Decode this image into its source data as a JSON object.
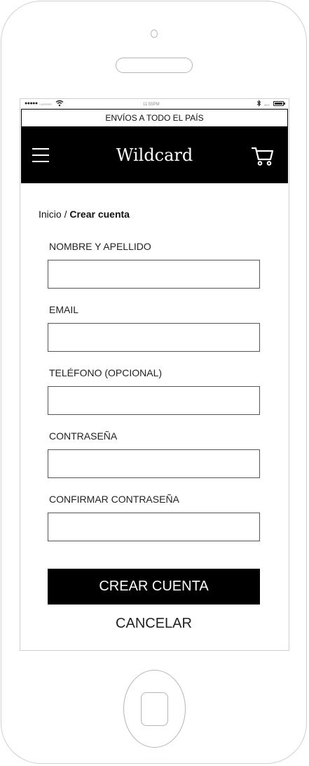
{
  "status_bar": {
    "signal": "●●●●●",
    "carrier": "CARRIER",
    "time": "11:55PM",
    "battery_pct": "88%"
  },
  "promo": {
    "text": "ENVÍOS A TODO EL PAÍS"
  },
  "header": {
    "brand": "Wildcard",
    "menu_icon": "hamburger-menu-icon",
    "cart_icon": "shopping-cart-icon",
    "background": "#000000",
    "foreground": "#ffffff"
  },
  "breadcrumb": {
    "home": "Inicio",
    "separator": " / ",
    "current": "Crear cuenta"
  },
  "form": {
    "fields": [
      {
        "label": "NOMBRE Y APELLIDO",
        "value": ""
      },
      {
        "label": "EMAIL",
        "value": ""
      },
      {
        "label": "TELÉFONO (OPCIONAL)",
        "value": ""
      },
      {
        "label": "CONTRASEÑA",
        "value": ""
      },
      {
        "label": "CONFIRMAR CONTRASEÑA",
        "value": ""
      }
    ],
    "submit_label": "CREAR CUENTA",
    "cancel_label": "CANCELAR"
  }
}
